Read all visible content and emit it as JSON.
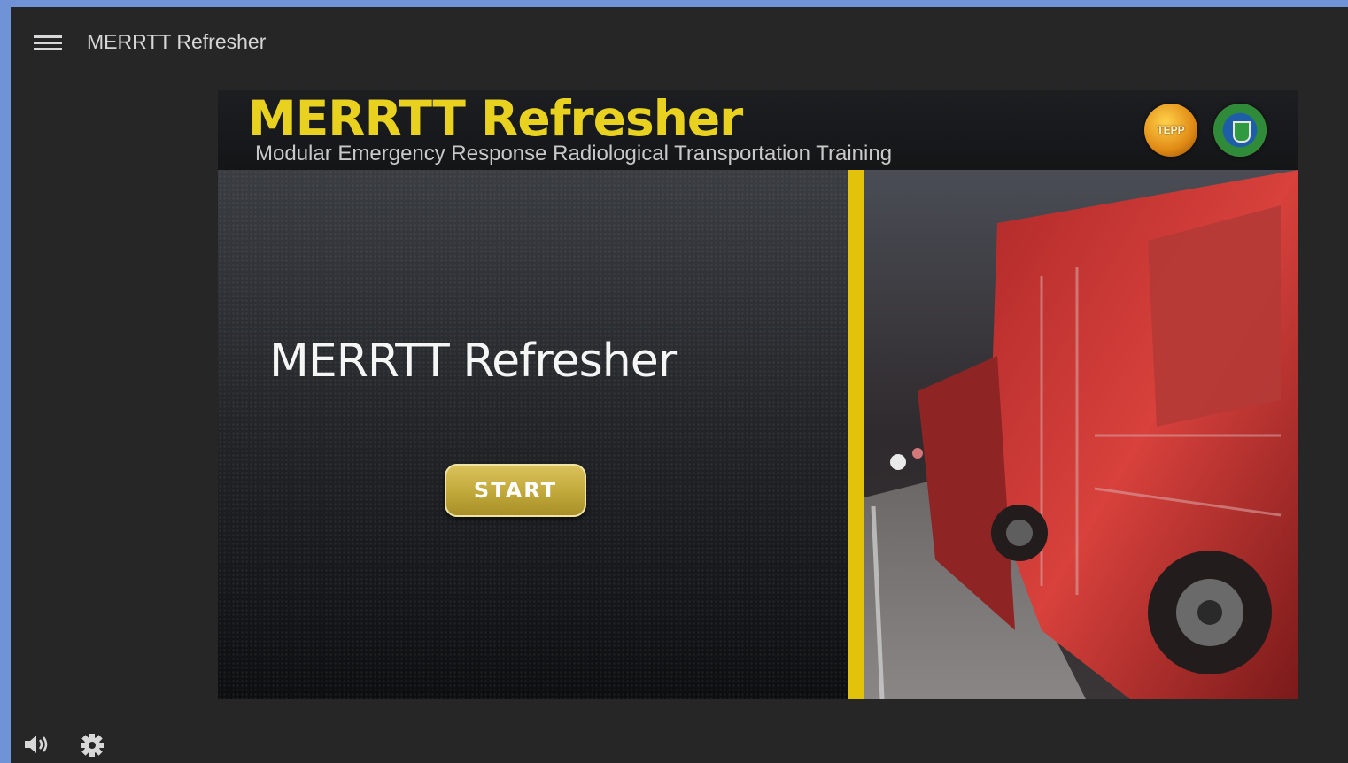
{
  "topbar": {
    "menu_icon": "hamburger-menu-icon",
    "title": "MERRTT Refresher"
  },
  "slide": {
    "header_title": "MERRTT Refresher",
    "header_subtitle": "Modular Emergency Response Radiological Transportation Training",
    "logos": {
      "tepp_label": "TEPP",
      "doe": "doe-seal-icon"
    },
    "main_title": "MERRTT Refresher",
    "start_label": "START",
    "accent_color": "#e3c20c",
    "photo": "fire-truck-night-photo"
  },
  "footer": {
    "volume_icon": "volume-icon",
    "settings_icon": "gear-icon"
  }
}
